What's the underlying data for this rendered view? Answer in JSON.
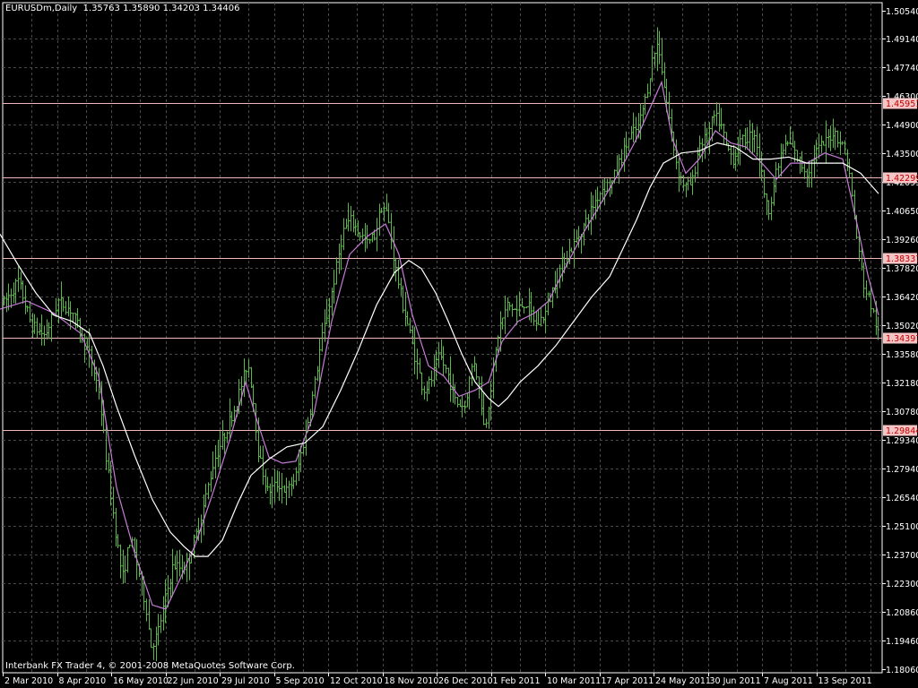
{
  "window": {
    "title": "EURUSDm,Daily  1.35763 1.35890 1.34203 1.34406",
    "footer": "Interbank FX Trader 4, © 2001-2008 MetaQuotes Software Corp."
  },
  "colors": {
    "background": "#000000",
    "grid": "#4a4a4a",
    "bars": "#5bb848",
    "ma_fast": "#c87bd8",
    "ma_slow": "#ffffff",
    "level_line": "#f2b8b8",
    "level_label_bg": "#f5c4c4",
    "level_label_text": "#c00000",
    "axis": "#ffffff"
  },
  "chart_data": {
    "type": "line",
    "symbol": "EURUSDm",
    "timeframe": "Daily",
    "ohlc_last": {
      "open": 1.35763,
      "high": 1.3589,
      "low": 1.34203,
      "close": 1.34406
    },
    "ylim": [
      1.1806,
      1.5054
    ],
    "price_ticks": [
      "1.50540",
      "1.49140",
      "1.47740",
      "1.46300",
      "1.44900",
      "1.43500",
      "1.42099",
      "1.40650",
      "1.39260",
      "1.37820",
      "1.36420",
      "1.35020",
      "1.33580",
      "1.32180",
      "1.30780",
      "1.29340",
      "1.27940",
      "1.26540",
      "1.25100",
      "1.23700",
      "1.22300",
      "1.20860",
      "1.19460",
      "1.18060"
    ],
    "date_labels": [
      "2 Mar 2010",
      "8 Apr 2010",
      "16 May 2010",
      "22 Jun 2010",
      "29 Jul 2010",
      "5 Sep 2010",
      "12 Oct 2010",
      "18 Nov 2010",
      "26 Dec 2010",
      "1 Feb 2011",
      "10 Mar 2011",
      "17 Apr 2011",
      "24 May 2011",
      "30 Jun 2011",
      "7 Aug 2011",
      "13 Sep 2011"
    ],
    "levels": [
      "1.45951",
      "1.42299",
      "1.38337",
      "1.34397",
      "1.29844"
    ],
    "price_path": [
      [
        0,
        1.358
      ],
      [
        20,
        1.372
      ],
      [
        35,
        1.35
      ],
      [
        50,
        1.345
      ],
      [
        65,
        1.362
      ],
      [
        80,
        1.357
      ],
      [
        90,
        1.345
      ],
      [
        100,
        1.335
      ],
      [
        110,
        1.318
      ],
      [
        118,
        1.285
      ],
      [
        128,
        1.25
      ],
      [
        136,
        1.225
      ],
      [
        145,
        1.245
      ],
      [
        155,
        1.228
      ],
      [
        163,
        1.21
      ],
      [
        168,
        1.192
      ],
      [
        175,
        1.197
      ],
      [
        183,
        1.213
      ],
      [
        193,
        1.232
      ],
      [
        203,
        1.23
      ],
      [
        210,
        1.234
      ],
      [
        218,
        1.246
      ],
      [
        228,
        1.263
      ],
      [
        238,
        1.283
      ],
      [
        250,
        1.296
      ],
      [
        262,
        1.31
      ],
      [
        270,
        1.322
      ],
      [
        276,
        1.332
      ],
      [
        281,
        1.318
      ],
      [
        288,
        1.286
      ],
      [
        298,
        1.268
      ],
      [
        310,
        1.272
      ],
      [
        320,
        1.268
      ],
      [
        330,
        1.276
      ],
      [
        340,
        1.296
      ],
      [
        350,
        1.318
      ],
      [
        358,
        1.342
      ],
      [
        366,
        1.358
      ],
      [
        374,
        1.376
      ],
      [
        382,
        1.396
      ],
      [
        390,
        1.402
      ],
      [
        400,
        1.396
      ],
      [
        410,
        1.39
      ],
      [
        418,
        1.395
      ],
      [
        426,
        1.41
      ],
      [
        432,
        1.404
      ],
      [
        440,
        1.38
      ],
      [
        448,
        1.362
      ],
      [
        456,
        1.348
      ],
      [
        464,
        1.332
      ],
      [
        472,
        1.318
      ],
      [
        480,
        1.322
      ],
      [
        490,
        1.335
      ],
      [
        500,
        1.325
      ],
      [
        508,
        1.312
      ],
      [
        518,
        1.31
      ],
      [
        528,
        1.334
      ],
      [
        535,
        1.318
      ],
      [
        540,
        1.298
      ],
      [
        548,
        1.322
      ],
      [
        556,
        1.348
      ],
      [
        566,
        1.36
      ],
      [
        576,
        1.357
      ],
      [
        586,
        1.362
      ],
      [
        598,
        1.35
      ],
      [
        608,
        1.356
      ],
      [
        618,
        1.37
      ],
      [
        628,
        1.382
      ],
      [
        640,
        1.39
      ],
      [
        652,
        1.4
      ],
      [
        662,
        1.41
      ],
      [
        672,
        1.418
      ],
      [
        682,
        1.42
      ],
      [
        692,
        1.432
      ],
      [
        702,
        1.443
      ],
      [
        712,
        1.448
      ],
      [
        720,
        1.462
      ],
      [
        728,
        1.482
      ],
      [
        734,
        1.49
      ],
      [
        740,
        1.47
      ],
      [
        748,
        1.446
      ],
      [
        756,
        1.426
      ],
      [
        764,
        1.418
      ],
      [
        772,
        1.42
      ],
      [
        780,
        1.44
      ],
      [
        788,
        1.442
      ],
      [
        796,
        1.453
      ],
      [
        803,
        1.45
      ],
      [
        810,
        1.438
      ],
      [
        818,
        1.432
      ],
      [
        826,
        1.44
      ],
      [
        834,
        1.443
      ],
      [
        842,
        1.445
      ],
      [
        848,
        1.428
      ],
      [
        856,
        1.405
      ],
      [
        864,
        1.422
      ],
      [
        872,
        1.436
      ],
      [
        880,
        1.44
      ],
      [
        890,
        1.432
      ],
      [
        900,
        1.425
      ],
      [
        910,
        1.436
      ],
      [
        920,
        1.44
      ],
      [
        930,
        1.446
      ],
      [
        938,
        1.44
      ],
      [
        946,
        1.43
      ],
      [
        952,
        1.405
      ],
      [
        958,
        1.385
      ],
      [
        964,
        1.368
      ],
      [
        970,
        1.362
      ],
      [
        976,
        1.352
      ],
      [
        980,
        1.344
      ]
    ],
    "ma_fast": [
      [
        0,
        1.358
      ],
      [
        30,
        1.362
      ],
      [
        60,
        1.356
      ],
      [
        90,
        1.346
      ],
      [
        110,
        1.325
      ],
      [
        130,
        1.27
      ],
      [
        150,
        1.238
      ],
      [
        170,
        1.212
      ],
      [
        185,
        1.21
      ],
      [
        200,
        1.224
      ],
      [
        218,
        1.242
      ],
      [
        238,
        1.268
      ],
      [
        258,
        1.296
      ],
      [
        274,
        1.322
      ],
      [
        286,
        1.304
      ],
      [
        300,
        1.285
      ],
      [
        315,
        1.282
      ],
      [
        330,
        1.283
      ],
      [
        350,
        1.306
      ],
      [
        370,
        1.352
      ],
      [
        390,
        1.385
      ],
      [
        410,
        1.394
      ],
      [
        430,
        1.4
      ],
      [
        445,
        1.385
      ],
      [
        460,
        1.355
      ],
      [
        478,
        1.33
      ],
      [
        495,
        1.325
      ],
      [
        512,
        1.315
      ],
      [
        530,
        1.318
      ],
      [
        545,
        1.322
      ],
      [
        560,
        1.342
      ],
      [
        578,
        1.352
      ],
      [
        596,
        1.356
      ],
      [
        612,
        1.362
      ],
      [
        630,
        1.378
      ],
      [
        650,
        1.395
      ],
      [
        670,
        1.41
      ],
      [
        690,
        1.425
      ],
      [
        710,
        1.442
      ],
      [
        728,
        1.46
      ],
      [
        738,
        1.47
      ],
      [
        750,
        1.442
      ],
      [
        765,
        1.425
      ],
      [
        780,
        1.432
      ],
      [
        798,
        1.446
      ],
      [
        815,
        1.44
      ],
      [
        832,
        1.438
      ],
      [
        850,
        1.43
      ],
      [
        866,
        1.422
      ],
      [
        882,
        1.43
      ],
      [
        900,
        1.43
      ],
      [
        920,
        1.435
      ],
      [
        940,
        1.432
      ],
      [
        956,
        1.4
      ],
      [
        968,
        1.375
      ],
      [
        980,
        1.355
      ]
    ],
    "ma_slow": [
      [
        0,
        1.395
      ],
      [
        20,
        1.38
      ],
      [
        40,
        1.366
      ],
      [
        60,
        1.355
      ],
      [
        80,
        1.352
      ],
      [
        100,
        1.346
      ],
      [
        115,
        1.33
      ],
      [
        130,
        1.31
      ],
      [
        150,
        1.286
      ],
      [
        170,
        1.264
      ],
      [
        190,
        1.248
      ],
      [
        205,
        1.241
      ],
      [
        218,
        1.236
      ],
      [
        232,
        1.236
      ],
      [
        248,
        1.244
      ],
      [
        265,
        1.262
      ],
      [
        280,
        1.276
      ],
      [
        300,
        1.284
      ],
      [
        320,
        1.29
      ],
      [
        340,
        1.292
      ],
      [
        360,
        1.3
      ],
      [
        380,
        1.318
      ],
      [
        400,
        1.338
      ],
      [
        420,
        1.36
      ],
      [
        440,
        1.376
      ],
      [
        456,
        1.382
      ],
      [
        470,
        1.378
      ],
      [
        486,
        1.366
      ],
      [
        500,
        1.352
      ],
      [
        515,
        1.336
      ],
      [
        530,
        1.322
      ],
      [
        545,
        1.314
      ],
      [
        556,
        1.31
      ],
      [
        566,
        1.314
      ],
      [
        580,
        1.322
      ],
      [
        600,
        1.33
      ],
      [
        620,
        1.34
      ],
      [
        640,
        1.352
      ],
      [
        660,
        1.364
      ],
      [
        680,
        1.374
      ],
      [
        695,
        1.388
      ],
      [
        710,
        1.402
      ],
      [
        725,
        1.418
      ],
      [
        740,
        1.43
      ],
      [
        760,
        1.435
      ],
      [
        780,
        1.436
      ],
      [
        800,
        1.44
      ],
      [
        820,
        1.438
      ],
      [
        840,
        1.432
      ],
      [
        860,
        1.432
      ],
      [
        880,
        1.433
      ],
      [
        900,
        1.43
      ],
      [
        920,
        1.43
      ],
      [
        940,
        1.43
      ],
      [
        960,
        1.425
      ],
      [
        980,
        1.415
      ]
    ]
  }
}
